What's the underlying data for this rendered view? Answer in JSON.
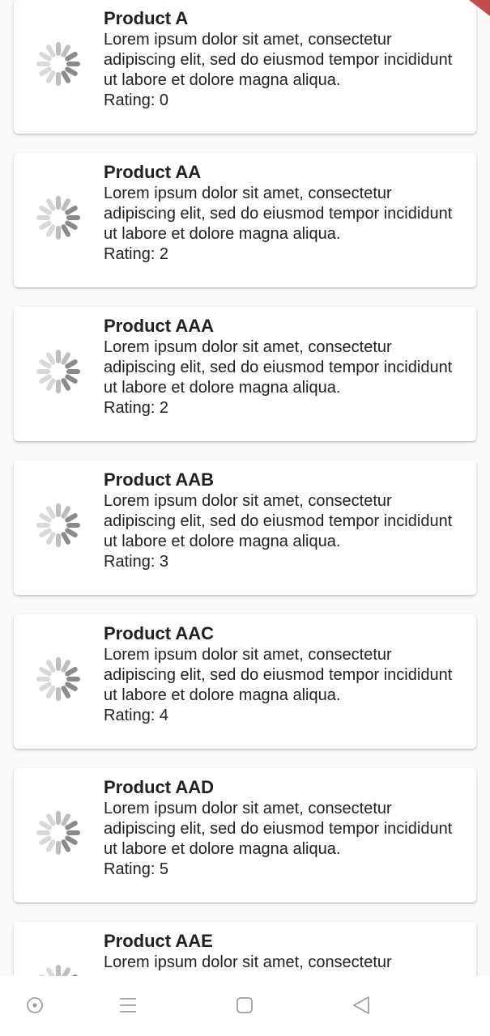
{
  "products": [
    {
      "name": "Product A",
      "description": "Lorem ipsum dolor sit amet, consectetur adipiscing elit, sed do eiusmod tempor incididunt ut labore et dolore magna aliqua.",
      "rating_text": "Rating: 0",
      "image_icon": "loading-spinner-icon"
    },
    {
      "name": "Product AA",
      "description": "Lorem ipsum dolor sit amet, consectetur adipiscing elit, sed do eiusmod tempor incididunt ut labore et dolore magna aliqua.",
      "rating_text": "Rating: 2",
      "image_icon": "loading-spinner-icon"
    },
    {
      "name": "Product AAA",
      "description": "Lorem ipsum dolor sit amet, consectetur adipiscing elit, sed do eiusmod tempor incididunt ut labore et dolore magna aliqua.",
      "rating_text": "Rating: 2",
      "image_icon": "loading-spinner-icon"
    },
    {
      "name": "Product AAB",
      "description": "Lorem ipsum dolor sit amet, consectetur adipiscing elit, sed do eiusmod tempor incididunt ut labore et dolore magna aliqua.",
      "rating_text": "Rating: 3",
      "image_icon": "loading-spinner-icon"
    },
    {
      "name": "Product AAC",
      "description": "Lorem ipsum dolor sit amet, consectetur adipiscing elit, sed do eiusmod tempor incididunt ut labore et dolore magna aliqua.",
      "rating_text": "Rating: 4",
      "image_icon": "loading-spinner-icon"
    },
    {
      "name": "Product AAD",
      "description": "Lorem ipsum dolor sit amet, consectetur adipiscing elit, sed do eiusmod tempor incididunt ut labore et dolore magna aliqua.",
      "rating_text": "Rating: 5",
      "image_icon": "loading-spinner-icon"
    },
    {
      "name": "Product AAE",
      "description": "Lorem ipsum dolor sit amet, consectetur",
      "rating_text": "",
      "image_icon": "loading-spinner-icon"
    }
  ],
  "navbar": {
    "items": [
      {
        "icon": "assistant-dot-icon"
      },
      {
        "icon": "menu-lines-icon"
      },
      {
        "icon": "home-square-icon"
      },
      {
        "icon": "back-triangle-icon"
      }
    ]
  },
  "colors": {
    "card_background": "#ffffff",
    "page_background": "#fafafa",
    "text": "#212121",
    "spinner_dark": "#8a8a8a",
    "spinner_light": "#d8d8d8",
    "debug_banner": "#c62828",
    "nav_icon": "#9e9e9e"
  }
}
